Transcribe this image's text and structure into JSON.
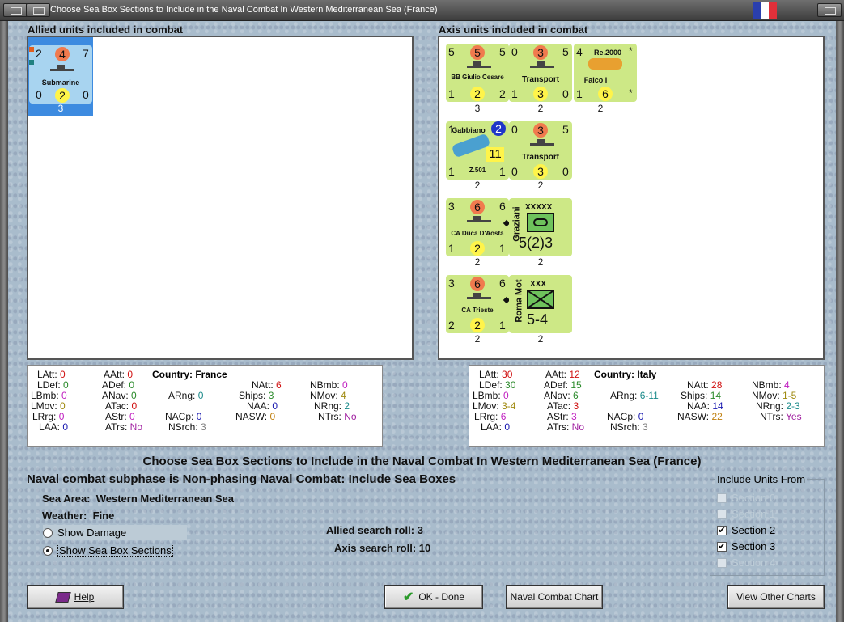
{
  "window": {
    "title": "Choose Sea Box Sections to Include in the Naval Combat In Western Mediterranean Sea (France)"
  },
  "allied": {
    "header": "Allied units included in combat",
    "units": [
      {
        "tl": "2",
        "top": "4",
        "tr": "7",
        "name": "Submarine",
        "bl": "0",
        "bot": "2",
        "br": "0",
        "below": "3"
      }
    ]
  },
  "axis": {
    "header": "Axis units included in combat",
    "units": [
      {
        "tl": "5",
        "top": "5",
        "tr": "5",
        "name": "BB Giulio Cesare",
        "bl": "1",
        "bot": "2",
        "br": "2",
        "below": "3"
      },
      {
        "tl": "0",
        "top": "3",
        "tr": "5",
        "name": "Transport",
        "bl": "1",
        "bot": "3",
        "br": "0",
        "below": "2"
      },
      {
        "tl": "4",
        "plane": "Re.2000",
        "pilot": "Falco I",
        "bl": "1",
        "bot": "6",
        "below": "2"
      },
      {
        "tl": "1",
        "plane": "Gabbiano",
        "badge": "2",
        "model": "Z.501",
        "big": "11",
        "bl": "1",
        "br": "1",
        "below": "2"
      },
      {
        "tl": "0",
        "top": "3",
        "tr": "5",
        "name": "Transport",
        "bl": "0",
        "bot": "3",
        "br": "0",
        "below": "2"
      },
      {
        "tl": "3",
        "top": "6",
        "tr": "6",
        "name": "CA Duca D'Aosta",
        "bl": "1",
        "bot": "2",
        "br": "1",
        "below": "2"
      },
      {
        "leader": "Graziani",
        "size": "XXXXX",
        "value": "5(2)3",
        "below": "2"
      },
      {
        "tl": "3",
        "top": "6",
        "tr": "6",
        "name": "CA Trieste",
        "bl": "2",
        "bot": "2",
        "br": "1",
        "below": "2"
      },
      {
        "leader": "Roma Mot",
        "size": "XXX",
        "value": "5-4",
        "below": "2"
      }
    ]
  },
  "allied_stats": {
    "country": "Country: France",
    "LAtt": "0",
    "AAtt": "0",
    "NAtt": "6",
    "NBmb": "0",
    "LDef": "0",
    "ADef": "0",
    "ARng": "0",
    "Ships": "3",
    "NMov": "4",
    "LBmb": "0",
    "ANav": "0",
    "NAA": "0",
    "NRng": "2",
    "LMov": "0",
    "ATac": "0",
    "NACp": "0",
    "NASW": "0",
    "NTrs": "No",
    "LRrg": "0",
    "AStr": "0",
    "NSrch": "3",
    "LAA": "0",
    "ATrs": "No"
  },
  "axis_stats": {
    "country": "Country: Italy",
    "LAtt": "30",
    "AAtt": "12",
    "NAtt": "28",
    "NBmb": "4",
    "LDef": "30",
    "ADef": "15",
    "ARng": "6-11",
    "Ships": "14",
    "NMov": "1-5",
    "LBmb": "0",
    "ANav": "6",
    "NAA": "14",
    "NRng": "2-3",
    "LMov": "3-4",
    "ATac": "3",
    "NACp": "0",
    "NASW": "22",
    "NTrs": "Yes",
    "LRrg": "6",
    "AStr": "3",
    "NSrch": "3",
    "LAA": "0",
    "ATrs": "No"
  },
  "labels": {
    "LAtt": "LAtt:",
    "AAtt": "AAtt:",
    "NAtt": "NAtt:",
    "NBmb": "NBmb:",
    "LDef": "LDef:",
    "ADef": "ADef:",
    "ARng": "ARng:",
    "Ships": "Ships:",
    "NMov": "NMov:",
    "LBmb": "LBmb:",
    "ANav": "ANav:",
    "NAA": "NAA:",
    "NRng": "NRng:",
    "LMov": "LMov:",
    "ATac": "ATac:",
    "NACp": "NACp:",
    "NASW": "NASW:",
    "NTrs": "NTrs:",
    "LRrg": "LRrg:",
    "AStr": "AStr:",
    "NSrch": "NSrch:",
    "LAA": "LAA:",
    "ATrs": "ATrs:"
  },
  "colors": {
    "att": "#d01010",
    "def": "#2a8a2a",
    "bmb": "#c020c0",
    "mov": "#a08a10",
    "rrg": "#c020c0",
    "aa": "#1a1ab0",
    "rng": "#1a8a8a",
    "tac": "#d01010",
    "str": "#c020c0",
    "trs": "#a020a0",
    "ships": "#2a8a2a",
    "nmov": "#a08a10",
    "naa": "#1a1ab0",
    "nrng": "#1a8a8a",
    "nacp": "#1a1ab0",
    "nasw": "#c08010",
    "srch": "#808080"
  },
  "main": {
    "heading": "Choose Sea Box Sections to Include in the Naval Combat In Western Mediterranean Sea (France)",
    "subphase": "Naval combat subphase is Non-phasing Naval Combat: Include Sea Boxes",
    "sea_area_label": "Sea Area:",
    "sea_area": "Western Mediterranean Sea",
    "weather_label": "Weather:",
    "weather": "Fine",
    "show_damage": "Show Damage",
    "show_sections": "Show Sea Box Sections",
    "allied_roll_label": "Allied search roll:",
    "allied_roll": "3",
    "axis_roll_label": "Axis search roll:",
    "axis_roll": "10"
  },
  "include": {
    "title": "Include Units From",
    "sections": [
      {
        "label": "Section 0",
        "checked": false,
        "enabled": false
      },
      {
        "label": "Section 1",
        "checked": false,
        "enabled": false
      },
      {
        "label": "Section 2",
        "checked": true,
        "enabled": true
      },
      {
        "label": "Section 3",
        "checked": true,
        "enabled": true
      },
      {
        "label": "Section 4",
        "checked": false,
        "enabled": false
      }
    ]
  },
  "buttons": {
    "help": "Help",
    "ok": "OK - Done",
    "chart": "Naval Combat Chart",
    "other": "View Other Charts"
  }
}
